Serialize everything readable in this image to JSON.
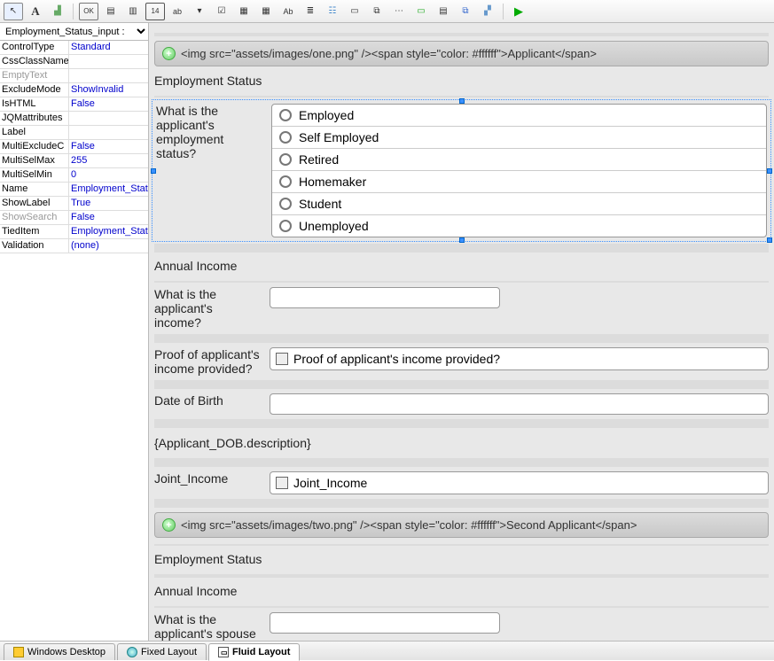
{
  "toolbar_items": [
    {
      "name": "pointer-tool",
      "glyph": "↖"
    },
    {
      "name": "text-tool",
      "glyph": "A"
    },
    {
      "name": "image-tool",
      "glyph": "img"
    },
    {
      "name": "ok-tool",
      "glyph": "OK"
    },
    {
      "name": "form-tool",
      "glyph": "▤"
    },
    {
      "name": "form2-tool",
      "glyph": "▤"
    },
    {
      "name": "calendar-tool",
      "glyph": "14"
    },
    {
      "name": "textbox-tool",
      "glyph": "ab"
    },
    {
      "name": "dropdown-tool",
      "glyph": "▾"
    },
    {
      "name": "checkbox-tool",
      "glyph": "☑"
    },
    {
      "name": "table-tool",
      "glyph": "▦"
    },
    {
      "name": "grid-tool",
      "glyph": "▦"
    },
    {
      "name": "richtext-tool",
      "glyph": "Ab"
    },
    {
      "name": "listbox-tool",
      "glyph": "≣"
    },
    {
      "name": "layout-tool",
      "glyph": "☷"
    },
    {
      "name": "panel-tool",
      "glyph": "▭"
    },
    {
      "name": "copy-tool",
      "glyph": "⧉"
    },
    {
      "name": "dots-tool",
      "glyph": "⋯"
    },
    {
      "name": "green-tool",
      "glyph": "▭"
    },
    {
      "name": "sheet-tool",
      "glyph": "▤"
    },
    {
      "name": "blue-tool",
      "glyph": "⧉"
    },
    {
      "name": "tiles-tool",
      "glyph": "▚"
    }
  ],
  "prop_selector": "Employment_Status_input :",
  "properties": [
    {
      "name": "ControlType",
      "value": "Standard"
    },
    {
      "name": "CssClassName",
      "value": ""
    },
    {
      "name": "EmptyText",
      "value": "",
      "disabled": true
    },
    {
      "name": "ExcludeMode",
      "value": "ShowInvalid"
    },
    {
      "name": "IsHTML",
      "value": "False"
    },
    {
      "name": "JQMattributes",
      "value": ""
    },
    {
      "name": "Label",
      "value": ""
    },
    {
      "name": "MultiExcludeC",
      "value": "False"
    },
    {
      "name": "MultiSelMax",
      "value": "255"
    },
    {
      "name": "MultiSelMin",
      "value": "0"
    },
    {
      "name": "Name",
      "value": "Employment_Statu"
    },
    {
      "name": "ShowLabel",
      "value": "True"
    },
    {
      "name": "ShowSearch",
      "value": "False",
      "disabled": true
    },
    {
      "name": "TiedItem",
      "value": "Employment_Statu"
    },
    {
      "name": "Validation",
      "value": "(none)"
    }
  ],
  "section1_raw": "<img src=\"assets/images/one.png\" /><span style=\"color: #ffffff\">Applicant</span>",
  "employment_heading": "Employment Status",
  "employment_question": "What is the applicant's employment status?",
  "employment_options": [
    "Employed",
    "Self Employed",
    "Retired",
    "Homemaker",
    "Student",
    "Unemployed"
  ],
  "annual_income_heading": "Annual Income",
  "income_question": "What is the applicant's income?",
  "proof_question": "Proof of applicant's income provided?",
  "proof_checkbox_label": "Proof of applicant's income provided?",
  "dob_label": "Date of Birth",
  "dob_desc": "{Applicant_DOB.description}",
  "joint_label": "Joint_Income",
  "joint_checkbox_label": "Joint_Income",
  "section2_raw": "<img src=\"assets/images/two.png\" /><span style=\"color: #ffffff\">Second Applicant</span>",
  "employment_heading2": "Employment Status",
  "annual_income_heading2": "Annual Income",
  "spouse_income_question": "What is the applicant's spouse income?",
  "tabs": [
    {
      "name": "windows-desktop",
      "label": "Windows Desktop",
      "icon": "ticon-win"
    },
    {
      "name": "fixed-layout",
      "label": "Fixed Layout",
      "icon": "ticon-globe"
    },
    {
      "name": "fluid-layout",
      "label": "Fluid Layout",
      "icon": "ticon-fluid",
      "active": true
    }
  ]
}
